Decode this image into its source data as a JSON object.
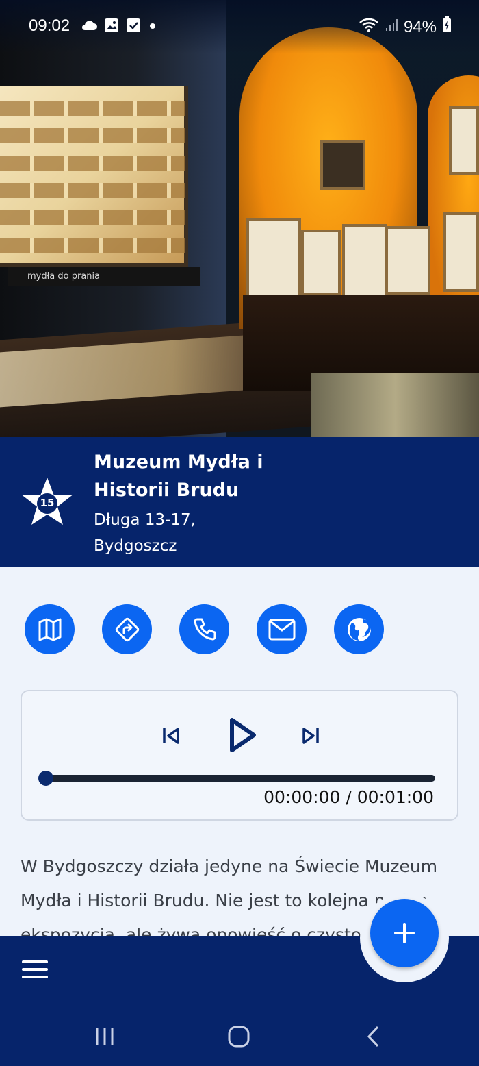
{
  "status_bar": {
    "time": "09:02",
    "battery": "94%",
    "icons": [
      "cloud-icon",
      "image-icon",
      "checkbox-icon",
      "dot-icon",
      "wifi-icon",
      "signal-icon",
      "battery-charging-icon"
    ]
  },
  "hero": {
    "plaque_text": "mydła do prania"
  },
  "place": {
    "badge_number": "15",
    "title": "Muzeum Mydła i Historii Brudu",
    "address_line1": "Długa 13-17,",
    "address_line2": "Bydgoszcz"
  },
  "actions": [
    "map-icon",
    "directions-icon",
    "phone-icon",
    "mail-icon",
    "globe-icon"
  ],
  "player": {
    "timecode": "00:00:00 / 00:01:00",
    "progress": 0
  },
  "description": "W Bydgoszczy działa jedyne na Świecie Muzeum Mydła i Historii Brudu. Nie jest to kolejna nudna ekspozycja, ale żywa opowieść o czystości...",
  "colors": {
    "brand_navy": "#06246b",
    "accent_blue": "#0b66f2",
    "background": "#eef3fb"
  }
}
